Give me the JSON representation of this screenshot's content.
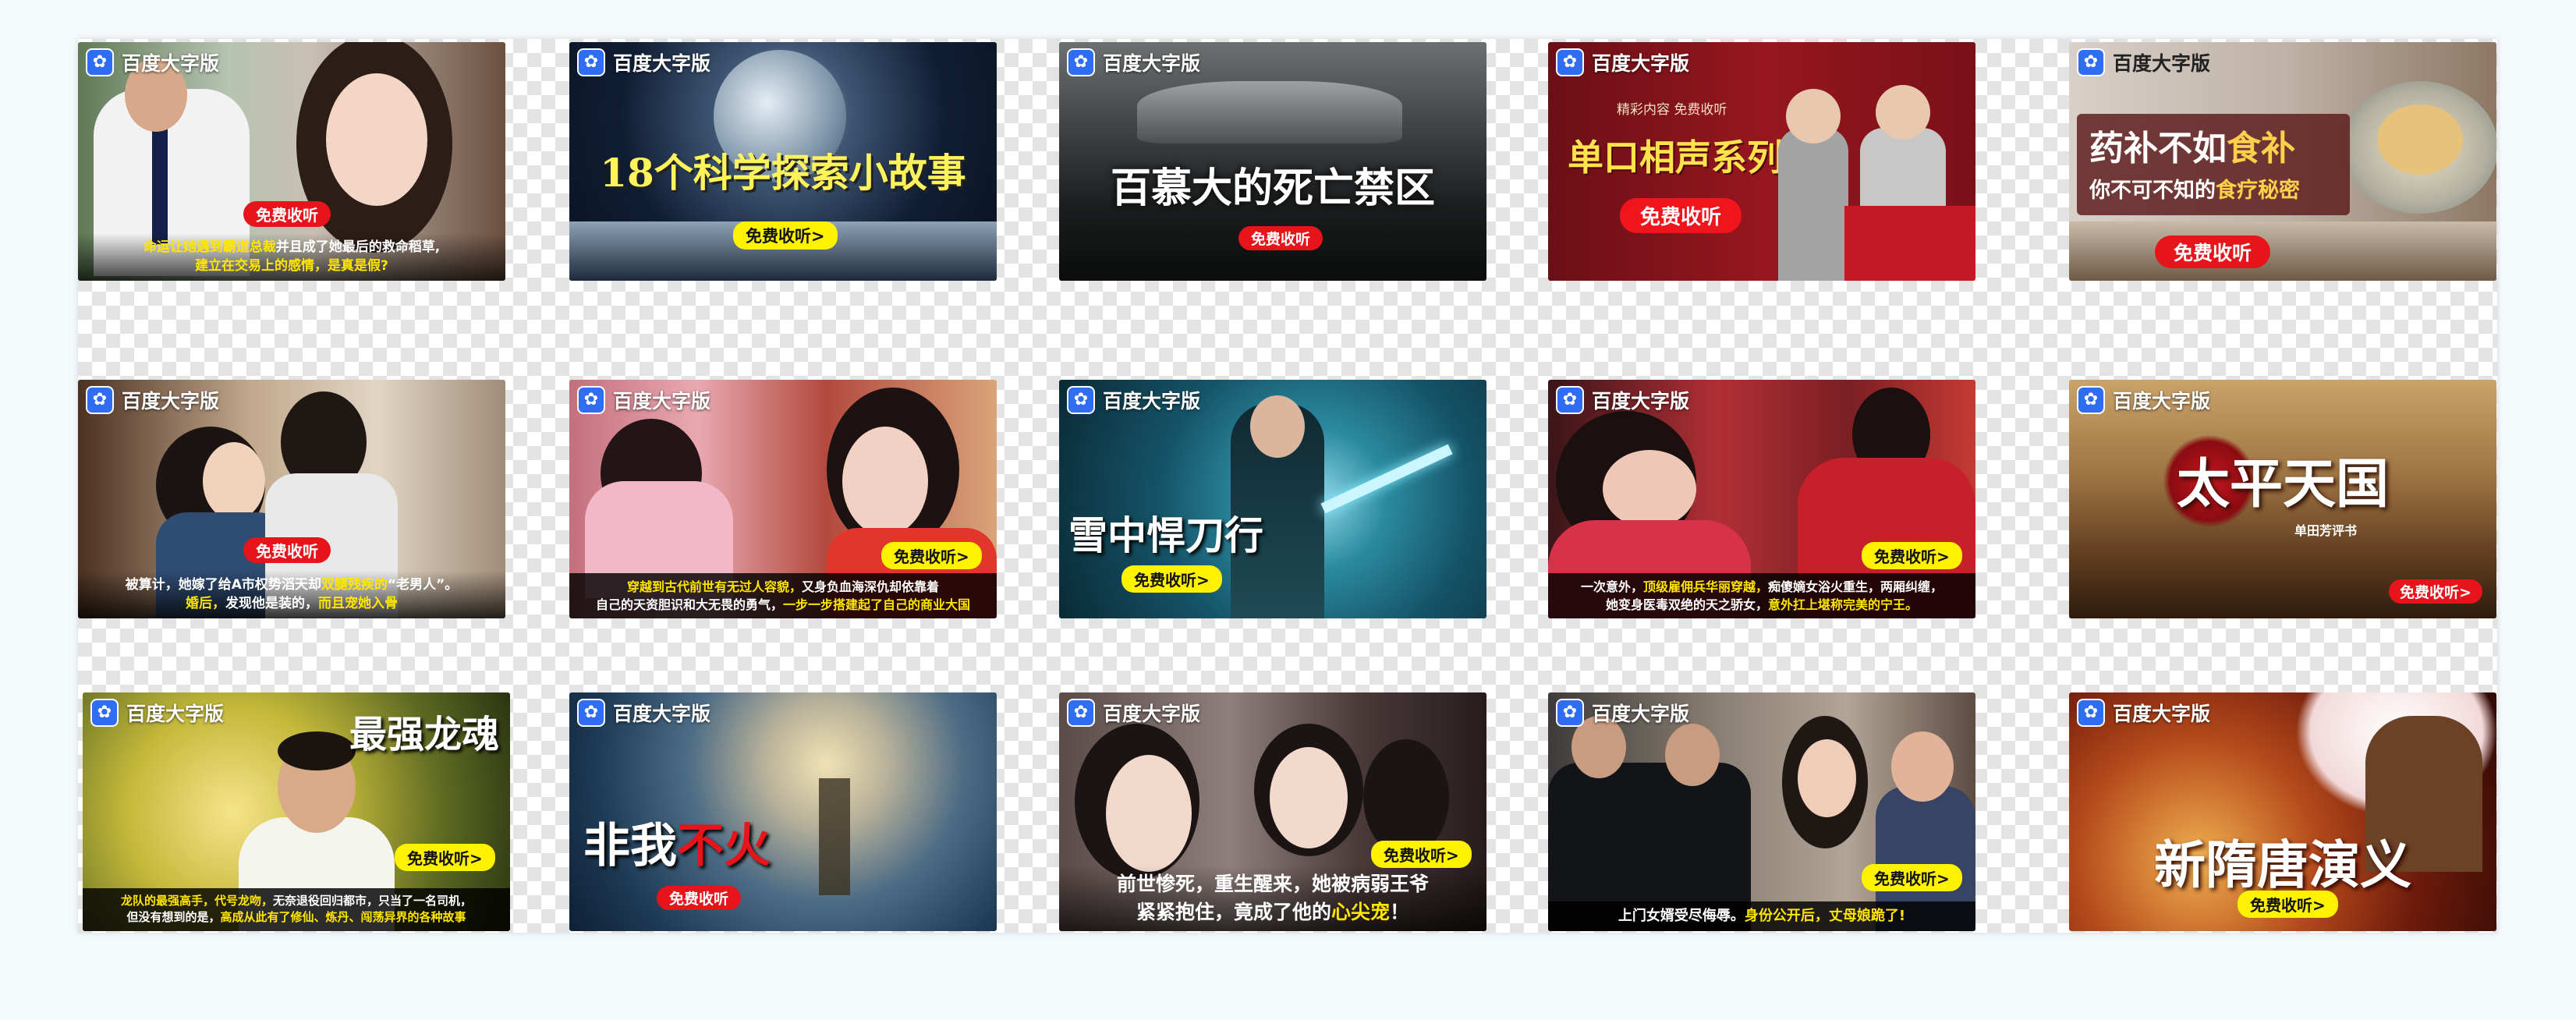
{
  "brand": {
    "name": "百度大字版",
    "logo_icon": "baidu-paw-icon",
    "logo_glyph": "✿"
  },
  "cards": [
    {
      "tag": "免费收听",
      "caption_plain_1": "命运让她遇到霸道总裁",
      "caption_white_1": "并且成了她最后的救命稻草,",
      "caption_line_2": "建立在交易上的感情，是真是假?"
    },
    {
      "title": "18个科学探索小故事",
      "tag": "免费收听>"
    },
    {
      "title": "百慕大的死亡禁区",
      "tag": "免费收听"
    },
    {
      "subtitle": "精彩内容 免费收听",
      "title": "单口相声系列",
      "tag": "免费收听"
    },
    {
      "title_a": "药补不如",
      "title_b": "食补",
      "subtitle_a": "你不可不知的",
      "subtitle_b": "食疗秘密",
      "tag": "免费收听"
    },
    {
      "tag": "免费收听",
      "caption_line_1a": "被算计，她嫁了给A市权势滔天却",
      "caption_line_1b": "双腿残疾的",
      "caption_line_1c": "“老男人”。",
      "caption_line_2a": "婚后，",
      "caption_line_2b": "发现他是装的，",
      "caption_line_2c": "而且宠她入骨"
    },
    {
      "tag": "免费收听>",
      "caption_line_1a": "穿越到古代前世有无过人容貌，",
      "caption_line_1b": "又身负血海深仇却依靠着",
      "caption_line_2a": "自己的天资胆识和大无畏的勇气，",
      "caption_line_2b": "一步一步搭建起了自己的商业大国"
    },
    {
      "title": "雪中悍刀行",
      "tag": "免费收听>"
    },
    {
      "tag": "免费收听>",
      "caption_line_1a": "一次意外，",
      "caption_line_1b": "顶级雇佣兵华丽穿越，",
      "caption_line_1c": "痴傻嫡女浴火重生，两厢纠缠，",
      "caption_line_2a": "她变身医毒双绝的天之骄女，",
      "caption_line_2b": "意外扛上堪称完美的宁王。"
    },
    {
      "title": "太平天国",
      "subtitle": "单田芳评书",
      "tag": "免费收听>"
    },
    {
      "title": "最强龙魂",
      "tag": "免费收听>",
      "caption_line_1a": "龙队的最强高手，代号龙吻，",
      "caption_line_1b": "无奈退役回归都市，只当了一名司机，",
      "caption_line_2a": "但没有想到的是，",
      "caption_line_2b": "高成从此有了修仙、炼丹、闯荡异界的各种故事"
    },
    {
      "title_a": "非我",
      "title_b": "不火",
      "tag": "免费收听"
    },
    {
      "tag": "免费收听>",
      "caption_line_1": "前世惨死，重生醒来，她被病弱王爷",
      "caption_line_2a": "紧紧抱住，竟成了他的",
      "caption_line_2b": "心尖宠",
      "caption_line_2c": "！"
    },
    {
      "tag": "免费收听>",
      "caption_line_1a": "上门女婿受尽侮辱。",
      "caption_line_1b": "身份公开后，丈母娘跪了!"
    },
    {
      "title": "新隋唐演义",
      "tag": "免费收听>"
    }
  ]
}
